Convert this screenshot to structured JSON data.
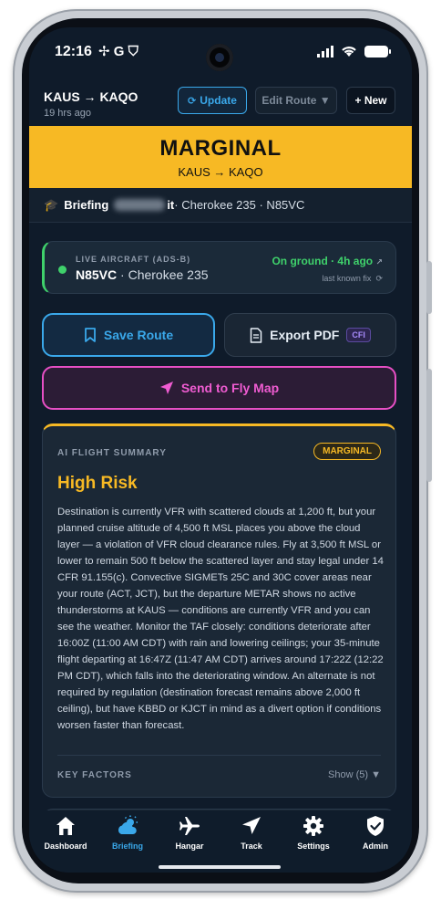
{
  "statusbar": {
    "time": "12:16",
    "left_icons": "✢ G ⛉"
  },
  "topbar": {
    "route_title": "KAUS → KAQO",
    "route_age": "19 hrs ago",
    "update_label": "Update",
    "edit_route_label": "Edit Route ▼",
    "new_label": "+ New"
  },
  "banner": {
    "title": "MARGINAL",
    "route": "KAUS → KAQO",
    "color": "#f7b924"
  },
  "briefing": {
    "label": "Briefing",
    "suffix": "it",
    "details": " · Cherokee 235 · N85VC"
  },
  "aircraft": {
    "label": "LIVE AIRCRAFT (ADS-B)",
    "tail": "N85VC",
    "model": " · Cherokee 235",
    "status": "On ground · 4h ago",
    "status_color": "#3fd16b",
    "fix_note": "last known fix"
  },
  "actions": {
    "save_route": "Save Route",
    "export_pdf": "Export PDF",
    "cfi_badge": "CFI",
    "send_to_fly_map": "Send to Fly Map"
  },
  "summary": {
    "label": "AI FLIGHT SUMMARY",
    "badge": "MARGINAL",
    "title": "High Risk",
    "text": "Destination is currently VFR with scattered clouds at 1,200 ft, but your planned cruise altitude of 4,500 ft MSL places you above the cloud layer — a violation of VFR cloud clearance rules. Fly at 3,500 ft MSL or lower to remain 500 ft below the scattered layer and stay legal under 14 CFR 91.155(c). Convective SIGMETs 25C and 30C cover areas near your route (ACT, JCT), but the departure METAR shows no active thunderstorms at KAUS — conditions are currently VFR and you can see the weather. Monitor the TAF closely: conditions deteriorate after 16:00Z (11:00 AM CDT) with rain and lowering ceilings; your 35-minute flight departing at 16:47Z (11:47 AM CDT) arrives around 17:22Z (12:22 PM CDT), which falls into the deteriorating window. An alternate is not required by regulation (destination forecast remains above 2,000 ft ceiling), but have KBBD or KJCT in mind as a divert option if conditions worsen faster than forecast.",
    "key_factors_label": "KEY FACTORS",
    "show_label": "Show (5) ▼"
  },
  "nav": [
    {
      "label": "Dashboard",
      "icon": "home-icon"
    },
    {
      "label": "Briefing",
      "icon": "weather-icon",
      "active": true
    },
    {
      "label": "Hangar",
      "icon": "plane-icon"
    },
    {
      "label": "Track",
      "icon": "navigation-arrow-icon"
    },
    {
      "label": "Settings",
      "icon": "gear-icon"
    },
    {
      "label": "Admin",
      "icon": "shield-check-icon"
    }
  ]
}
